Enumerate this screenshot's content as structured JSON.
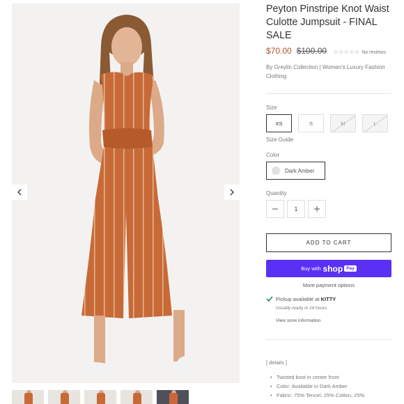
{
  "gallery": {
    "prev_icon": "chevron-left-icon",
    "next_icon": "chevron-right-icon",
    "thumbnail_count": 5
  },
  "product": {
    "title": "Peyton Pinstripe Knot Waist Culotte Jumpsuit - FINAL SALE",
    "price": "$70.00",
    "compare_price": "$100.00",
    "rating_stars": 0,
    "reviews": "No reviews",
    "vendor": "By Greylin Collection | Women's Luxury Fashion Clothing"
  },
  "options": {
    "size_label": "Size",
    "sizes": [
      {
        "label": "XS",
        "state": "selected"
      },
      {
        "label": "S",
        "state": "available"
      },
      {
        "label": "M",
        "state": "sold-out"
      },
      {
        "label": "L",
        "state": "sold-out"
      }
    ],
    "size_guide": "Size Guide",
    "color_label": "Color",
    "color_value": "Dark Amber",
    "quantity_label": "Quantity",
    "quantity_value": "1"
  },
  "actions": {
    "add_to_cart": "ADD TO CART",
    "buy_with": "Buy with",
    "shop_word": "shop",
    "pay_badge": "Pay",
    "more_payment": "More payment options"
  },
  "pickup": {
    "text": "Pickup available at",
    "location": "KITTY",
    "ready": "Usually ready in 24 hours",
    "store_link": "View store information"
  },
  "details": {
    "heading": "[ details ]",
    "items": [
      "Twisted knot in center front",
      "Color: Available in Dark Amber",
      "Fabric: 75% Tencel, 25% Cotton, 25%"
    ]
  },
  "colors": {
    "price": "#b5532a",
    "shop_pay": "#5a31f4",
    "jumpsuit": "#c86a38",
    "check": "#1f8a5b"
  }
}
